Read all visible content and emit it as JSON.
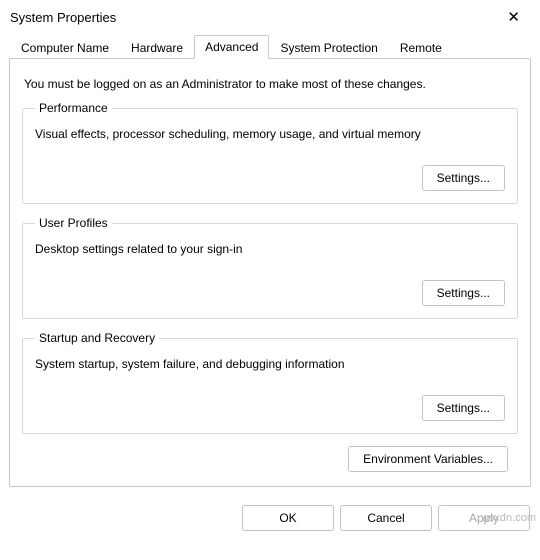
{
  "window": {
    "title": "System Properties"
  },
  "tabs": {
    "computer_name": "Computer Name",
    "hardware": "Hardware",
    "advanced": "Advanced",
    "system_protection": "System Protection",
    "remote": "Remote"
  },
  "body": {
    "intro": "You must be logged on as an Administrator to make most of these changes.",
    "performance": {
      "legend": "Performance",
      "desc": "Visual effects, processor scheduling, memory usage, and virtual memory",
      "button": "Settings..."
    },
    "user_profiles": {
      "legend": "User Profiles",
      "desc": "Desktop settings related to your sign-in",
      "button": "Settings..."
    },
    "startup": {
      "legend": "Startup and Recovery",
      "desc": "System startup, system failure, and debugging information",
      "button": "Settings..."
    },
    "env_button": "Environment Variables..."
  },
  "footer": {
    "ok": "OK",
    "cancel": "Cancel",
    "apply": "Apply"
  },
  "watermark": "wsxdn.com"
}
